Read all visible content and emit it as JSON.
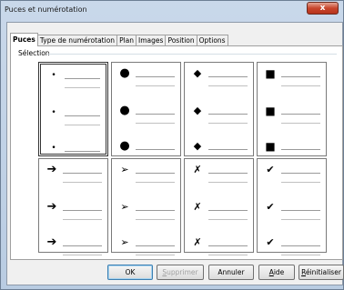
{
  "window": {
    "title": "Puces et numérotation",
    "close_glyph": "x"
  },
  "tabs": [
    {
      "label": "Puces",
      "active": true
    },
    {
      "label": "Type de numérotation",
      "active": false
    },
    {
      "label": "Plan",
      "active": false
    },
    {
      "label": "Images",
      "active": false
    },
    {
      "label": "Position",
      "active": false
    },
    {
      "label": "Options",
      "active": false
    }
  ],
  "selection": {
    "label": "Sélection",
    "selected_index": 0,
    "cells": [
      {
        "icon": "small-dot-bullet",
        "glyph": "•"
      },
      {
        "icon": "large-circle-bullet",
        "glyph": "●"
      },
      {
        "icon": "diamond-bullet",
        "glyph": "◆"
      },
      {
        "icon": "square-bullet",
        "glyph": "■"
      },
      {
        "icon": "arrow-bullet",
        "glyph": "➔"
      },
      {
        "icon": "arrowhead-bullet",
        "glyph": "➢"
      },
      {
        "icon": "x-mark-bullet",
        "glyph": "✗"
      },
      {
        "icon": "check-mark-bullet",
        "glyph": "✔"
      }
    ]
  },
  "buttons": {
    "ok": "OK",
    "delete_prefix": "",
    "delete_u": "S",
    "delete_rest": "upprimer",
    "cancel": "Annuler",
    "help_u": "A",
    "help_rest": "ide",
    "reset_u": "R",
    "reset_rest": "éinitialiser"
  }
}
